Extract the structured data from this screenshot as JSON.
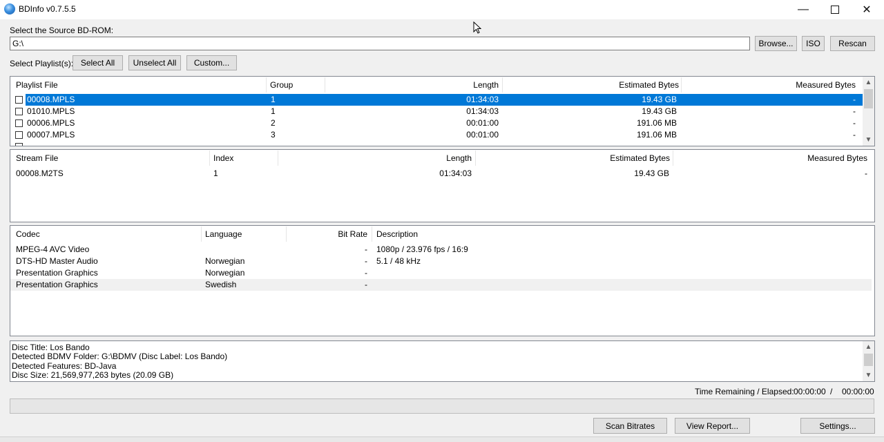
{
  "window": {
    "title": "BDInfo v0.7.5.5"
  },
  "source": {
    "label": "Select the Source BD-ROM:",
    "path": "G:\\"
  },
  "buttons": {
    "browse": "Browse...",
    "iso": "ISO",
    "rescan": "Rescan",
    "select_all": "Select All",
    "unselect_all": "Unselect All",
    "custom": "Custom...",
    "scan_bitrates": "Scan Bitrates",
    "view_report": "View Report...",
    "settings": "Settings..."
  },
  "playlist": {
    "label": "Select Playlist(s):",
    "headers": [
      "Playlist File",
      "Group",
      "Length",
      "Estimated Bytes",
      "Measured Bytes"
    ],
    "rows": [
      {
        "file": "00008.MPLS",
        "group": "1",
        "length": "01:34:03",
        "est": "19.43 GB",
        "meas": "-",
        "selected": true
      },
      {
        "file": "01010.MPLS",
        "group": "1",
        "length": "01:34:03",
        "est": "19.43 GB",
        "meas": "-"
      },
      {
        "file": "00006.MPLS",
        "group": "2",
        "length": "00:01:00",
        "est": "191.06 MB",
        "meas": "-"
      },
      {
        "file": "00007.MPLS",
        "group": "3",
        "length": "00:01:00",
        "est": "191.06 MB",
        "meas": "-"
      }
    ]
  },
  "streams": {
    "headers": [
      "Stream File",
      "Index",
      "Length",
      "Estimated Bytes",
      "Measured Bytes"
    ],
    "rows": [
      {
        "file": "00008.M2TS",
        "index": "1",
        "length": "01:34:03",
        "est": "19.43 GB",
        "meas": "-"
      }
    ]
  },
  "codecs": {
    "headers": [
      "Codec",
      "Language",
      "Bit Rate",
      "Description"
    ],
    "rows": [
      {
        "codec": "MPEG-4 AVC Video",
        "language": "",
        "bitrate": "-",
        "desc": "1080p / 23.976 fps / 16:9"
      },
      {
        "codec": "DTS-HD Master Audio",
        "language": "Norwegian",
        "bitrate": "-",
        "desc": "5.1 / 48 kHz"
      },
      {
        "codec": "Presentation Graphics",
        "language": "Norwegian",
        "bitrate": "-",
        "desc": ""
      },
      {
        "codec": "Presentation Graphics",
        "language": "Swedish",
        "bitrate": "-",
        "desc": ""
      }
    ]
  },
  "info": {
    "lines": [
      "Disc Title: Los Bando",
      "Detected BDMV Folder: G:\\BDMV (Disc Label: Los Bando)",
      "Detected Features: BD-Java",
      "Disc Size: 21,569,977,263 bytes (20.09 GB)"
    ]
  },
  "status": {
    "label": "Time Remaining / Elapsed:",
    "remaining": "00:00:00",
    "separator": "/",
    "elapsed": "00:00:00"
  },
  "colors": {
    "selection": "#0078d7",
    "window_bg": "#f0f0f0"
  }
}
